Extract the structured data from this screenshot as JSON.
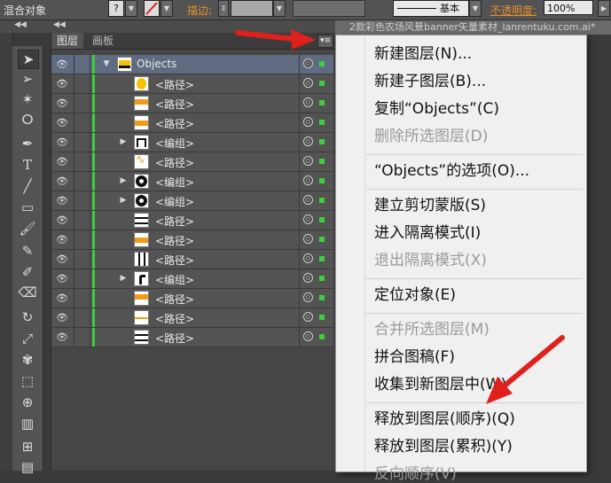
{
  "topbar": {
    "blend_label": "混合对象",
    "stroke_label": "描边:",
    "stroke_style": "基本",
    "opacity_label": "不透明度:",
    "opacity_value": "100%",
    "question_mark": "?"
  },
  "document": {
    "tab_title": "2款彩色农场风景banner矢量素材_lanrentuku.com.ai*"
  },
  "layers_panel": {
    "tabs": [
      {
        "label": "图层",
        "active": true
      },
      {
        "label": "画板",
        "active": false
      }
    ],
    "menu_button_icon": "panel-menu-icon",
    "rows": [
      {
        "name": "Objects",
        "type": "layer",
        "expanded": true,
        "thumb": "truck"
      },
      {
        "name": "<路径>",
        "type": "path",
        "thumb": "circle-yellow"
      },
      {
        "name": "<路径>",
        "type": "path",
        "thumb": "stripes-orange"
      },
      {
        "name": "<路径>",
        "type": "path",
        "thumb": "bar-orange"
      },
      {
        "name": "<编组>",
        "type": "group",
        "thumb": "gate"
      },
      {
        "name": "<路径>",
        "type": "path",
        "thumb": "wave"
      },
      {
        "name": "<编组>",
        "type": "group",
        "thumb": "wheel"
      },
      {
        "name": "<编组>",
        "type": "group",
        "thumb": "wheel"
      },
      {
        "name": "<路径>",
        "type": "path",
        "thumb": "lines-black"
      },
      {
        "name": "<路径>",
        "type": "path",
        "thumb": "bar-orange"
      },
      {
        "name": "<路径>",
        "type": "path",
        "thumb": "vlines"
      },
      {
        "name": "<编组>",
        "type": "group",
        "thumb": "corner"
      },
      {
        "name": "<路径>",
        "type": "path",
        "thumb": "stripes-orange"
      },
      {
        "name": "<路径>",
        "type": "path",
        "thumb": "line-orange"
      },
      {
        "name": "<路径>",
        "type": "path",
        "thumb": "lines-black"
      }
    ]
  },
  "context_menu": {
    "items": [
      {
        "label": "新建图层(N)...",
        "enabled": true
      },
      {
        "label": "新建子图层(B)...",
        "enabled": true
      },
      {
        "label": "复制“Objects”(C)",
        "enabled": true
      },
      {
        "label": "删除所选图层(D)",
        "enabled": false
      },
      {
        "separator": true
      },
      {
        "label": "“Objects”的选项(O)...",
        "enabled": true
      },
      {
        "separator": true
      },
      {
        "label": "建立剪切蒙版(S)",
        "enabled": true
      },
      {
        "label": "进入隔离模式(I)",
        "enabled": true
      },
      {
        "label": "退出隔离模式(X)",
        "enabled": false
      },
      {
        "separator": true
      },
      {
        "label": "定位对象(E)",
        "enabled": true
      },
      {
        "separator": true
      },
      {
        "label": "合并所选图层(M)",
        "enabled": false
      },
      {
        "label": "拼合图稿(F)",
        "enabled": true
      },
      {
        "label": "收集到新图层中(W)",
        "enabled": true
      },
      {
        "separator": true
      },
      {
        "label": "释放到图层(顺序)(Q)",
        "enabled": true
      },
      {
        "label": "释放到图层(累积)(Y)",
        "enabled": true
      },
      {
        "label": "反向顺序(V)",
        "enabled": false
      }
    ]
  },
  "colors": {
    "accent_orange": "#e8912a",
    "layer_color": "#3dcf3d",
    "annotation_red": "#e0201c"
  }
}
